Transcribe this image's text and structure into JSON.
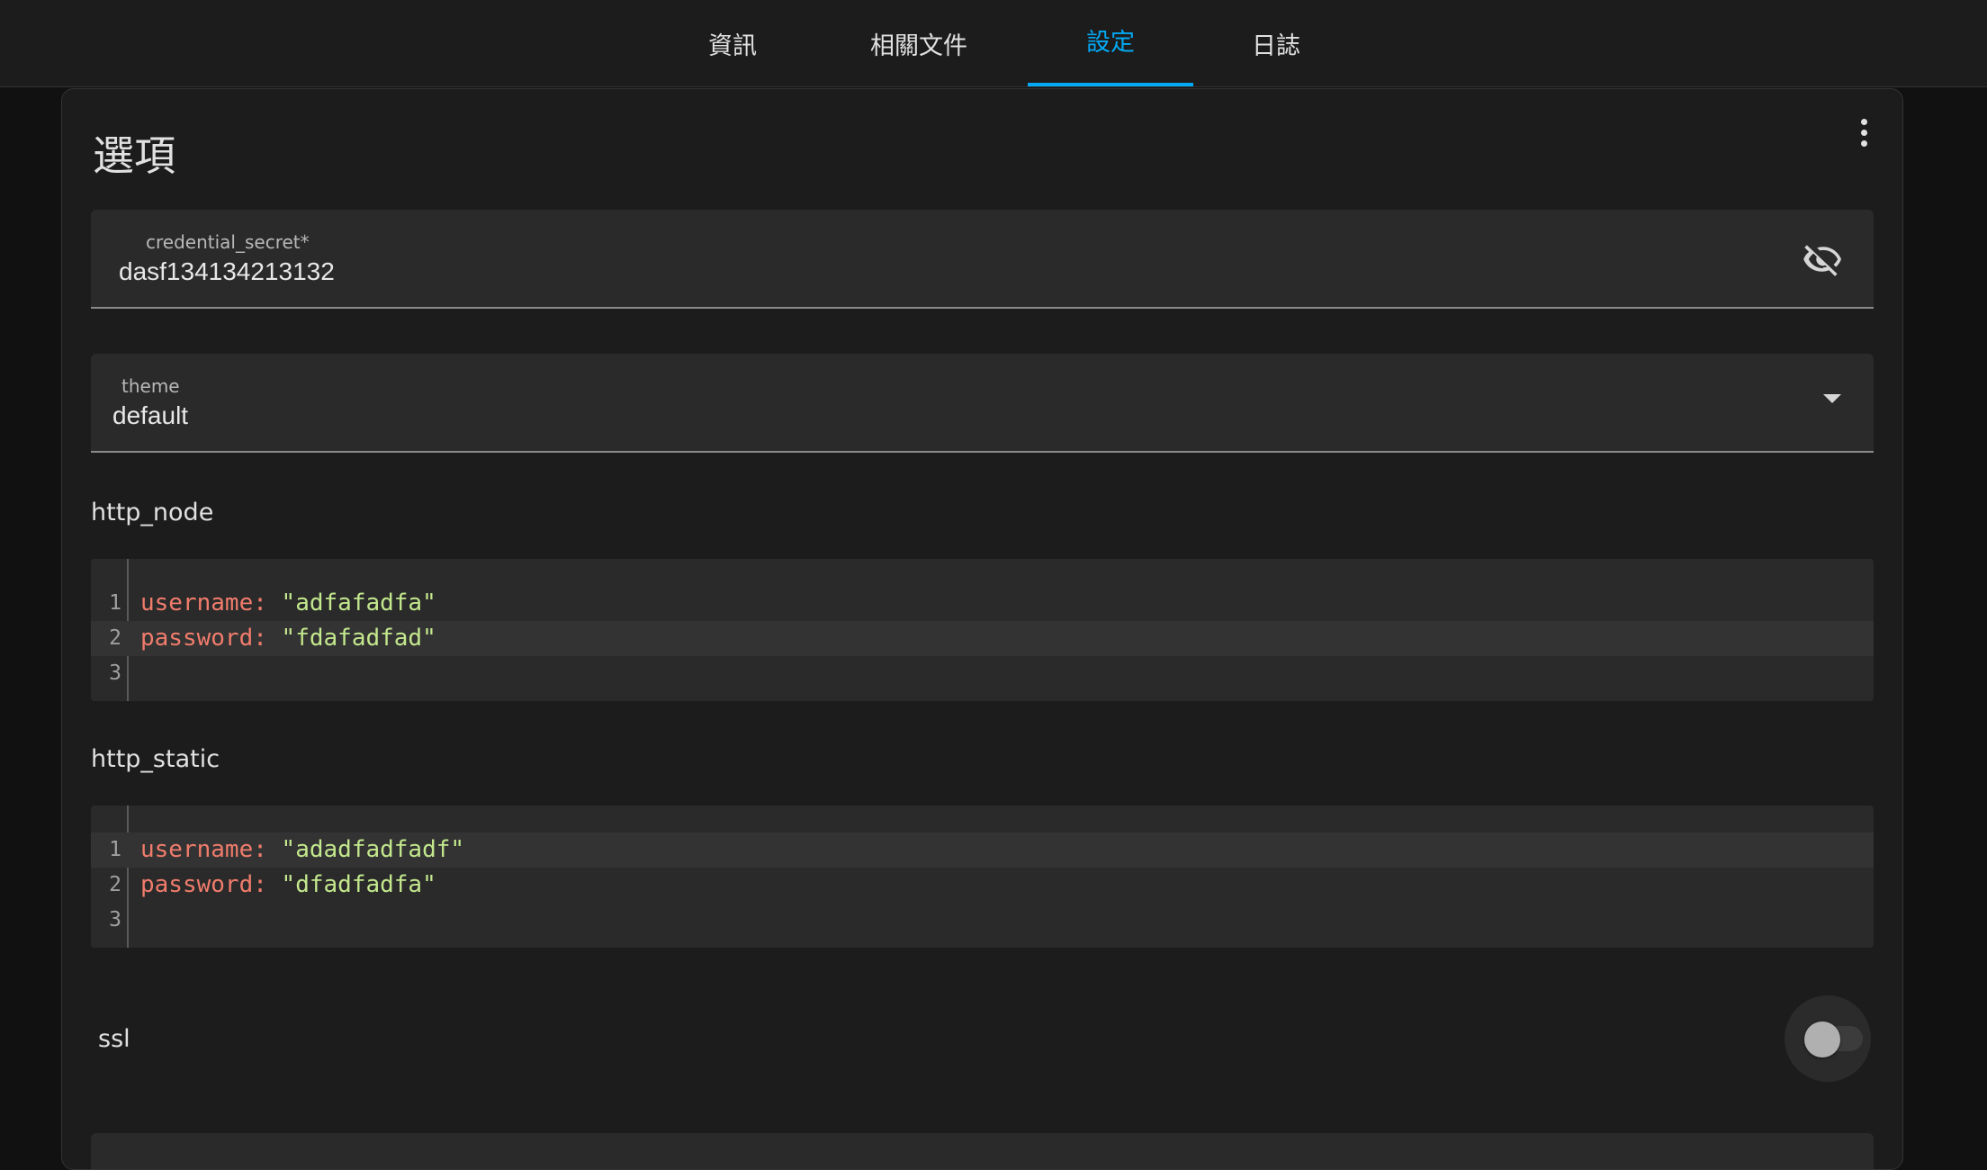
{
  "tabs": [
    {
      "label": "資訊",
      "active": false
    },
    {
      "label": "相關文件",
      "active": false
    },
    {
      "label": "設定",
      "active": true
    },
    {
      "label": "日誌",
      "active": false
    }
  ],
  "card": {
    "title": "選項"
  },
  "credential_field": {
    "label": "credential_secret*",
    "value": "dasf134134213132",
    "icon": "eye-off-icon"
  },
  "theme_field": {
    "label": "theme",
    "value": "default",
    "icon": "chevron-down-icon"
  },
  "http_node": {
    "label": "http_node",
    "lines": [
      {
        "num": "1",
        "key": "username",
        "colon": ":",
        "value": "\"adfafadfa\""
      },
      {
        "num": "2",
        "key": "password",
        "colon": ":",
        "value": "\"fdafadfad\""
      },
      {
        "num": "3",
        "key": "",
        "colon": "",
        "value": ""
      }
    ]
  },
  "http_static": {
    "label": "http_static",
    "lines": [
      {
        "num": "1",
        "key": "username",
        "colon": ":",
        "value": "\"adadfadfadf\""
      },
      {
        "num": "2",
        "key": "password",
        "colon": ":",
        "value": "\"dfadfadfa\""
      },
      {
        "num": "3",
        "key": "",
        "colon": "",
        "value": ""
      }
    ]
  },
  "ssl": {
    "label": "ssl",
    "enabled": false
  },
  "colors": {
    "accent": "#03a9f4",
    "background": "#111111",
    "surface": "#1c1c1c",
    "field": "#2a2a2a",
    "yaml_key": "#f07c6c",
    "yaml_string": "#c3e88d"
  }
}
